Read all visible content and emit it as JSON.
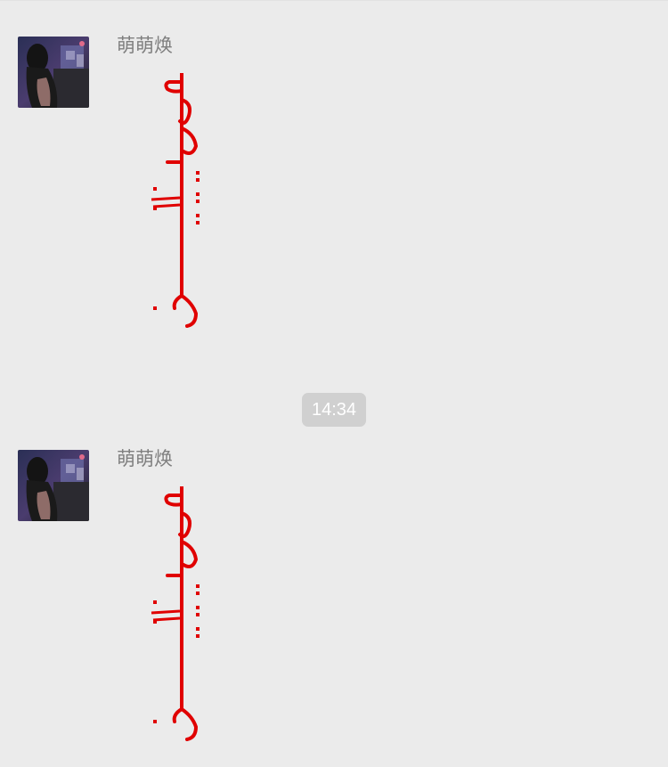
{
  "chat": {
    "messages": [
      {
        "sender": "萌萌焕",
        "type": "sticker",
        "sticker_icon": "mongolian-script-sticker"
      },
      {
        "sender": "萌萌焕",
        "type": "sticker",
        "sticker_icon": "mongolian-script-sticker"
      }
    ],
    "timestamp": "14:34"
  },
  "colors": {
    "background": "#ebebeb",
    "sender_name": "#7f7f7f",
    "timestamp_bg": "#d0d0d0",
    "sticker_red": "#e00000"
  }
}
